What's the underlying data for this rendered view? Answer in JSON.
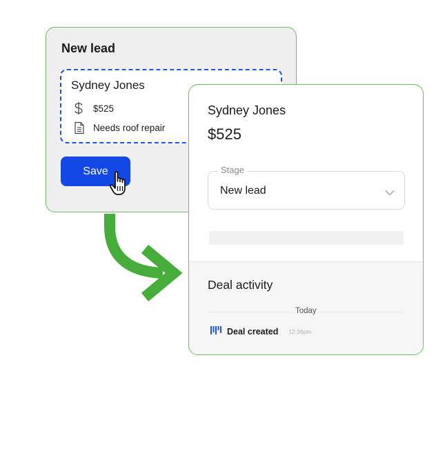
{
  "left_card": {
    "title": "New lead",
    "contact_name": "Sydney Jones",
    "amount": "$525",
    "note": "Needs roof repair",
    "save_label": "Save"
  },
  "right_card": {
    "contact_name": "Sydney Jones",
    "amount": "$525",
    "stage": {
      "label": "Stage",
      "value": "New lead"
    },
    "activity": {
      "title": "Deal activity",
      "date_divider": "Today",
      "events": [
        {
          "label": "Deal created",
          "time": "12:36pm",
          "icon": "pipeline-icon"
        }
      ]
    }
  },
  "colors": {
    "accent_green": "#5cb84c",
    "button_blue": "#1448e6",
    "dashed_blue": "#1f52e6"
  }
}
